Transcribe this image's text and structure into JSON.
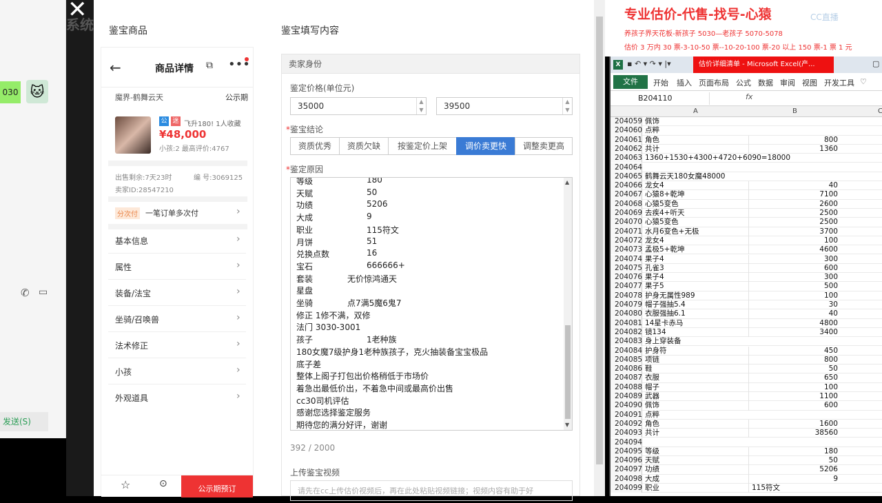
{
  "chat": {
    "bubble_text": "030",
    "send_label": "发送(S)",
    "call_icon": "phone-icon",
    "video_icon": "video-icon"
  },
  "top_partial": "系统",
  "app": {
    "left_header": "鉴宝商品",
    "right_header": "鉴宝填写内容",
    "product": {
      "page_title": "商品详情",
      "server": "魔界-鹤舞云天",
      "publicity": "公示期",
      "tag_public": "公",
      "tag_safe": "迷",
      "fly_text": "飞升180! 1人收藏",
      "price": "¥48,000",
      "kids_rating": "小孩:2 最高评价:4767",
      "remaining": "出售剩余:7天23时",
      "code": "编 号:3069125",
      "seller_id": "卖家ID:28547210",
      "installment_tag": "分次付",
      "installment_text": "一笔订单多次付",
      "menu": [
        "基本信息",
        "属性",
        "装备/法宝",
        "坐骑/召唤兽",
        "法术修正",
        "小孩",
        "外观道具"
      ],
      "bottom_btn1": "收藏",
      "bottom_btn2": "还价",
      "bottom_cta": "公示期预订"
    },
    "form": {
      "section_title": "卖家身份",
      "price_label": "鉴定价格(单位元)",
      "price_min": "35000",
      "price_max": "39500",
      "conclusion_label": "鉴宝结论",
      "conclusions": [
        "资质优秀",
        "资质欠缺",
        "按鉴定价上架",
        "调价卖更快",
        "调整卖更高"
      ],
      "reason_label": "鉴定原因",
      "reason_lines": [
        {
          "k": "等级",
          "v": "180",
          "indent": 1
        },
        {
          "k": "天赋",
          "v": "50",
          "indent": 1
        },
        {
          "k": "功绩",
          "v": "5206",
          "indent": 1
        },
        {
          "k": "大成",
          "v": "9",
          "indent": 1
        },
        {
          "k": "职业",
          "v": "115符文",
          "indent": 1
        },
        {
          "k": "月饼",
          "v": "51",
          "indent": 1
        },
        {
          "k": "兑换点数",
          "v": "16",
          "indent": 1
        },
        {
          "k": "宝石",
          "v": "666666+",
          "indent": 1
        },
        {
          "k": "套装",
          "v": "无价惊鸿通天",
          "indent": 2
        },
        {
          "k": "星盘",
          "v": "",
          "indent": 0
        },
        {
          "k": "坐骑",
          "v": "点7满5魔6鬼7",
          "indent": 2
        },
        {
          "k": "修正 1修不满，双修",
          "v": "",
          "indent": 0
        },
        {
          "k": "法门 3030-3001",
          "v": "",
          "indent": 0
        },
        {
          "k": "孩子",
          "v": "1老种族",
          "indent": 1
        },
        {
          "k": "180女魔7级护身1老种族孩子，克火抽装备宝宝极品",
          "v": "",
          "indent": 0
        },
        {
          "k": "底子差",
          "v": "",
          "indent": 0
        },
        {
          "k": "整体上阁子打包出价格稍低于市场价",
          "v": "",
          "indent": 0
        },
        {
          "k": "着急出最低价出，不着急中间或最高价出售",
          "v": "",
          "indent": 0
        },
        {
          "k": "cc30司机评估",
          "v": "",
          "indent": 0
        },
        {
          "k": "感谢您选择鉴定服务",
          "v": "",
          "indent": 0
        },
        {
          "k": "期待您的满分好评，谢谢",
          "v": "",
          "indent": 0
        }
      ],
      "char_count": "392 / 2000",
      "video_label": "上传鉴宝视频",
      "video_placeholder": "请先在cc上传估价视频后，再在此处粘贴视频链接；视频内容有助于好"
    }
  },
  "announcement": {
    "title": "专业估价-代售-找号-心猿",
    "line1": "养孩子界天花板-新孩子 5030—老孩子 5070-5078",
    "line2": "估价 3 万内 30 票-3-10-50 票--10-20-100 票-20 以上 150 票-1 票 1 元",
    "watermark": "CC直播"
  },
  "excel": {
    "title": "估价详细清单 - Microsoft Excel(产...",
    "tabs": [
      "开始",
      "插入",
      "页面布局",
      "公式",
      "数据",
      "审阅",
      "视图",
      "开发工具"
    ],
    "file_tab": "文件",
    "name_box": "B204110",
    "fx": "fx",
    "col_a": "A",
    "col_b": "B",
    "col_c": "C",
    "rows": [
      [
        "204059",
        "佩饰",
        ""
      ],
      [
        "204060",
        "点粹",
        ""
      ],
      [
        "204061",
        "角色",
        "800"
      ],
      [
        "204062",
        "共计",
        "1360"
      ],
      [
        "204063",
        "1360+1530+4300+4720+6090=18000",
        ""
      ],
      [
        "204064",
        "",
        ""
      ],
      [
        "204065",
        "鹤舞云天180女魔48000",
        ""
      ],
      [
        "204066",
        "龙女4",
        "40"
      ],
      [
        "204067",
        "心猿8+乾坤",
        "7100"
      ],
      [
        "204068",
        "心猿5变色",
        "2600"
      ],
      [
        "204069",
        "去疾4+听天",
        "2500"
      ],
      [
        "204070",
        "心猿5变色",
        "2500"
      ],
      [
        "204071",
        "水月6变色+无极",
        "3700"
      ],
      [
        "204072",
        "龙女4",
        "100"
      ],
      [
        "204073",
        "孟极5+乾坤",
        "4600"
      ],
      [
        "204074",
        "果子4",
        "300"
      ],
      [
        "204075",
        "孔雀3",
        "600"
      ],
      [
        "204076",
        "果子4",
        "300"
      ],
      [
        "204077",
        "果子5",
        "500"
      ],
      [
        "204078",
        "护身无属性989",
        "100"
      ],
      [
        "204079",
        "帽子强抽5.4",
        "30"
      ],
      [
        "204080",
        "衣服强抽6.1",
        "40"
      ],
      [
        "204081",
        "14星卡赤马",
        "4800"
      ],
      [
        "204082",
        "镜134",
        "3400"
      ],
      [
        "204083",
        "身上穿装备",
        ""
      ],
      [
        "204084",
        "护身符",
        "450"
      ],
      [
        "204085",
        "项链",
        "800"
      ],
      [
        "204086",
        "鞋",
        "50"
      ],
      [
        "204087",
        "衣服",
        "650"
      ],
      [
        "204088",
        "帽子",
        "100"
      ],
      [
        "204089",
        "武器",
        "1100"
      ],
      [
        "204090",
        "佩饰",
        "600"
      ],
      [
        "204091",
        "点粹",
        ""
      ],
      [
        "204092",
        "角色",
        "1600"
      ],
      [
        "204093",
        "共计",
        "38560"
      ],
      [
        "204094",
        "",
        ""
      ],
      [
        "204095",
        "等级",
        "180"
      ],
      [
        "204096",
        "天赋",
        "50"
      ],
      [
        "204097",
        "功绩",
        "5206"
      ],
      [
        "204098",
        "大成",
        "9"
      ],
      [
        "204099",
        "职业",
        "115符文"
      ]
    ]
  }
}
